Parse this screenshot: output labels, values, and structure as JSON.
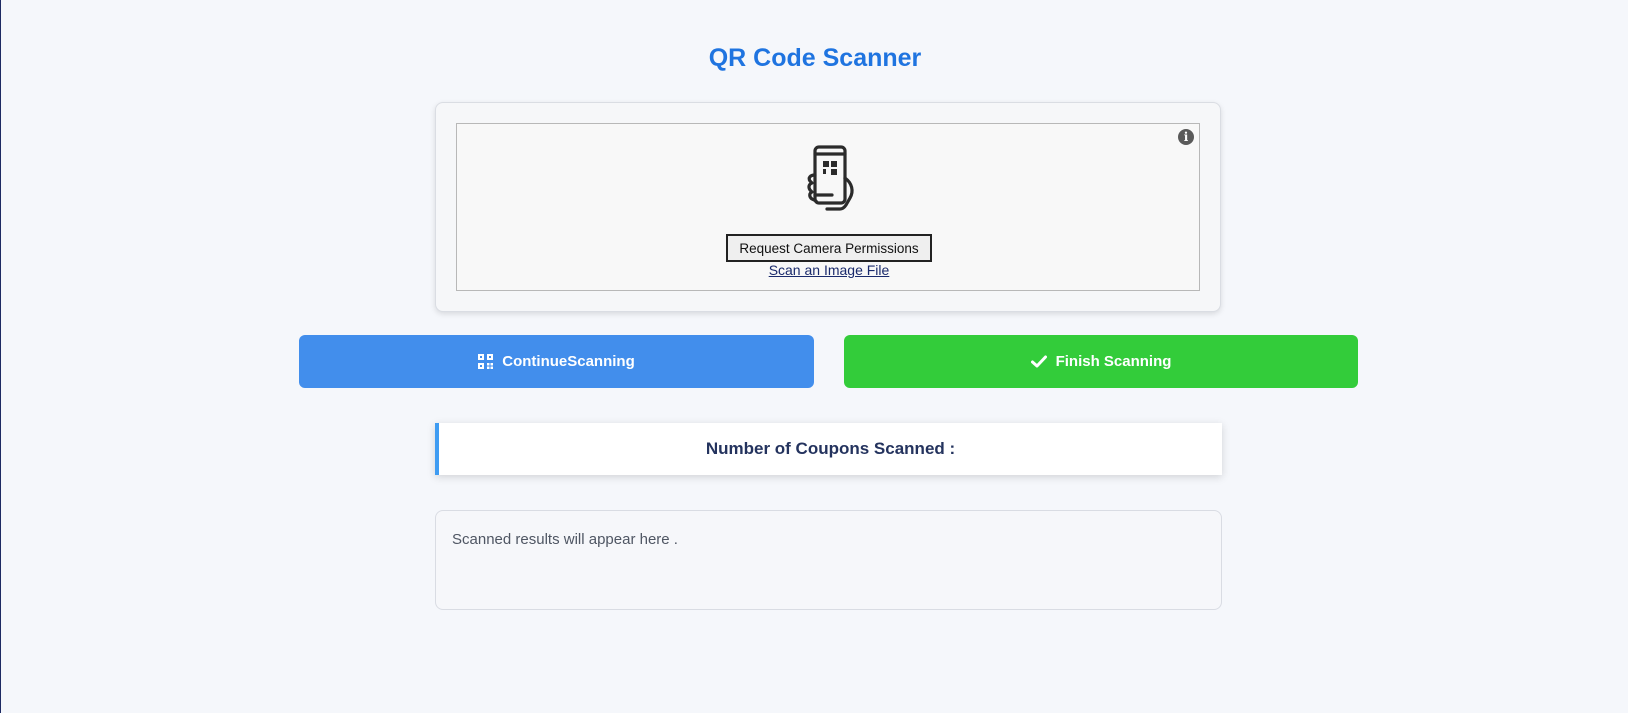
{
  "page": {
    "title": "QR Code Scanner"
  },
  "scanner": {
    "info_icon_glyph": "i",
    "illustration_icon": "phone-qr-scan-icon",
    "request_permission_label": "Request Camera Permissions",
    "scan_image_file_label": "Scan an Image File"
  },
  "actions": {
    "continue_label": "ContinueScanning",
    "continue_icon": "qrcode-icon",
    "finish_label": "Finish Scanning",
    "finish_icon": "check-icon"
  },
  "coupons": {
    "label": "Number of Coupons Scanned :"
  },
  "results": {
    "placeholder": "Scanned results will appear here ."
  },
  "colors": {
    "title": "#1f74e0",
    "continue_button": "#428eec",
    "finish_button": "#33cc3a",
    "coupon_accent": "#3f9cf2",
    "background": "#f5f7fb"
  }
}
